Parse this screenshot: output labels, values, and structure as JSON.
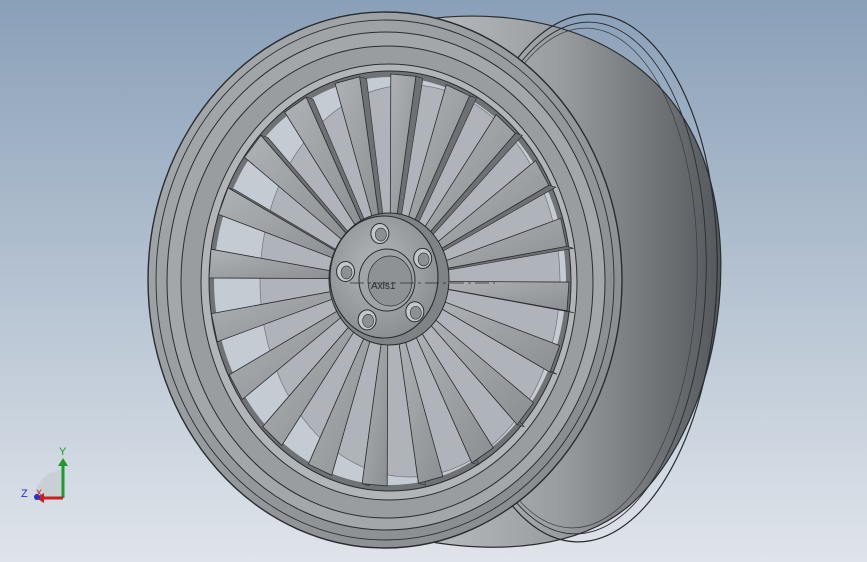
{
  "viewport": {
    "background_top": "#8aa0b8",
    "background_bottom": "#dfe4ea"
  },
  "model": {
    "part": "wheel-rim",
    "spoke_count": 20,
    "bolt_hole_count": 5,
    "axis_label": "Axis1",
    "body_color": "#9ea2a5",
    "edge_color": "#2a2d30"
  },
  "triad": {
    "y_label": "Y",
    "z_label": "Z",
    "x_label": "X",
    "y_color": "#1e9b2a",
    "x_color": "#c8201e",
    "z_color": "#2430c8"
  }
}
